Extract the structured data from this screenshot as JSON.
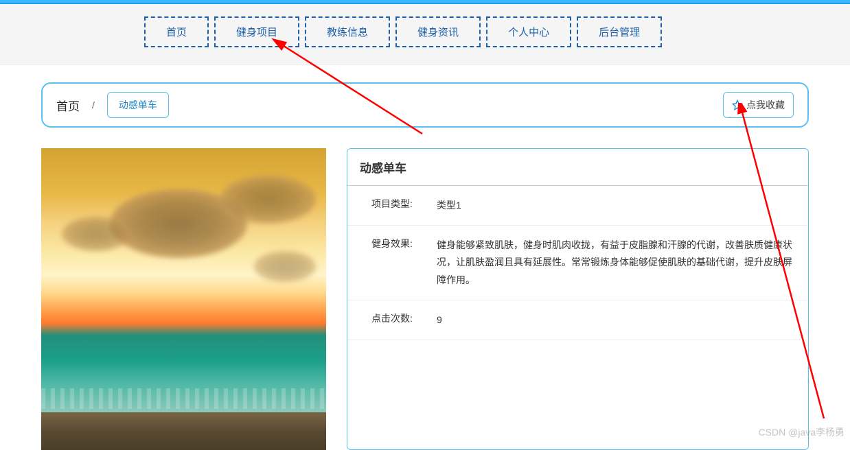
{
  "nav": {
    "items": [
      "首页",
      "健身项目",
      "教练信息",
      "健身资讯",
      "个人中心",
      "后台管理"
    ]
  },
  "breadcrumb": {
    "home": "首页",
    "separator": "/",
    "current": "动感单车"
  },
  "favorite": {
    "label": "点我收藏"
  },
  "detail": {
    "title": "动感单车",
    "rows": [
      {
        "label": "项目类型:",
        "value": "类型1"
      },
      {
        "label": "健身效果:",
        "value": "健身能够紧致肌肤，健身时肌肉收拢，有益于皮脂腺和汗腺的代谢，改善肤质健康状况，让肌肤盈润且具有延展性。常常锻炼身体能够促使肌肤的基础代谢，提升皮肤屏障作用。"
      },
      {
        "label": "点击次数:",
        "value": "9"
      }
    ]
  },
  "watermark": "CSDN @java李杨勇"
}
